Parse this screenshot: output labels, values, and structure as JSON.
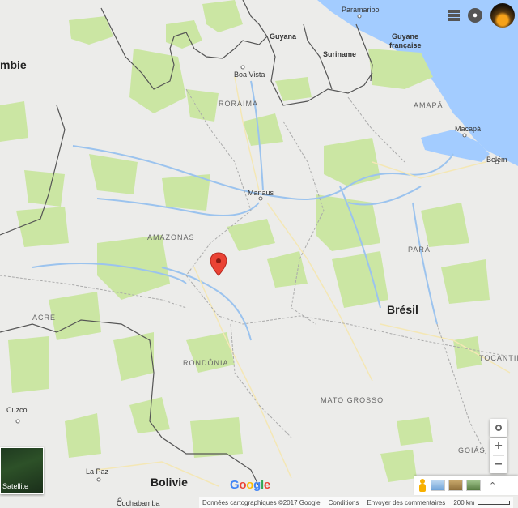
{
  "labels": {
    "countries": {
      "colombia_partial": "mbie",
      "guyana": "Guyana",
      "suriname": "Suriname",
      "guyane_line1": "Guyane",
      "guyane_line2": "française",
      "bresil": "Brésil",
      "bolivie": "Bolivie"
    },
    "states": {
      "roraima": "RORAIMA",
      "amapa": "AMAPÁ",
      "amazonas": "AMAZONAS",
      "para": "PARÁ",
      "acre": "ACRE",
      "rondonia": "RONDÔNIA",
      "mato_grosso": "MATO GROSSO",
      "tocantins_partial": "TOCANTIN",
      "goias": "GOIÁS"
    },
    "cities": {
      "paramaribo": "Paramaribo",
      "boa_vista": "Boa Vista",
      "macapa": "Macapá",
      "belem": "Belém",
      "manaus": "Manaus",
      "cuzco": "Cuzco",
      "la_paz": "La Paz",
      "cochabamba": "Cochabamba"
    }
  },
  "controls": {
    "satellite_label": "Satellite",
    "zoom_in": "+",
    "zoom_out": "−"
  },
  "attribution": {
    "map_data": "Données cartographiques ©2017 Google",
    "terms": "Conditions",
    "feedback": "Envoyer des commentaires",
    "scale": "200 km"
  },
  "colors": {
    "land": "#ececea",
    "forest": "#cbe6a3",
    "water": "#a3ccff",
    "river": "#9bc3ee",
    "border": "#555555",
    "marker": "#ea4335"
  }
}
